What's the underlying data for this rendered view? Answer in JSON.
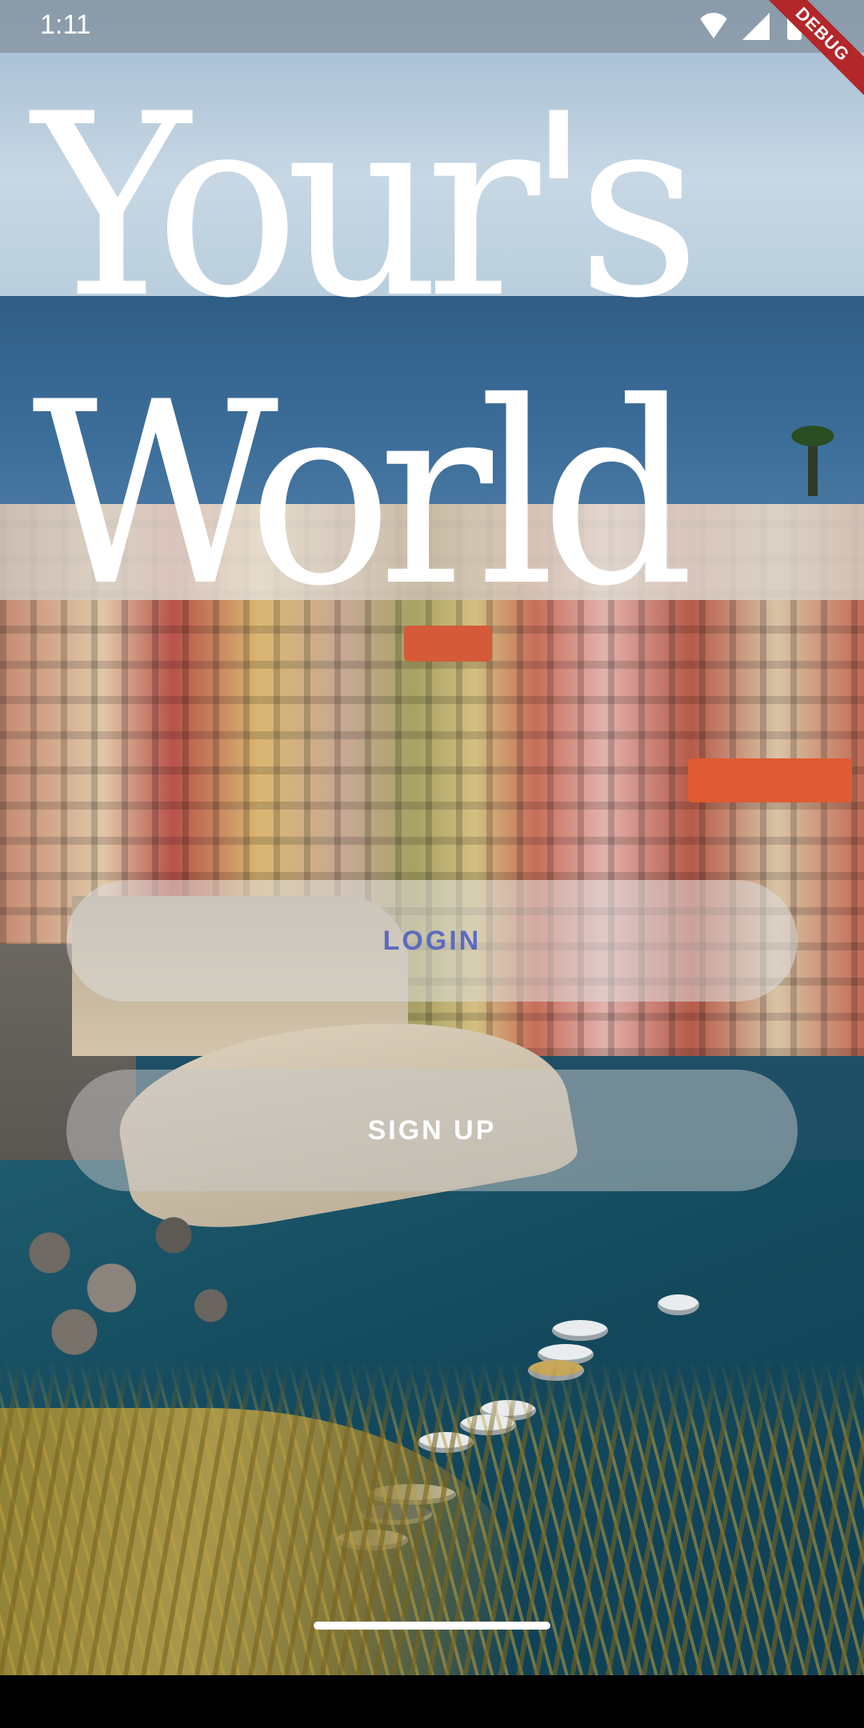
{
  "status_bar": {
    "time": "1:11",
    "debug_label": "DEBUG"
  },
  "title": {
    "line1": "Your's",
    "line2": "World"
  },
  "buttons": {
    "login_label": "LOGIN",
    "signup_label": "SIGN UP"
  },
  "colors": {
    "login_text": "#5c6bc0",
    "signup_text": "#ffffff",
    "button_bg": "rgba(220,220,220,0.55)",
    "debug_banner": "#b3262a"
  },
  "icons": [
    "wifi-icon",
    "cell-signal-icon",
    "battery-icon"
  ]
}
